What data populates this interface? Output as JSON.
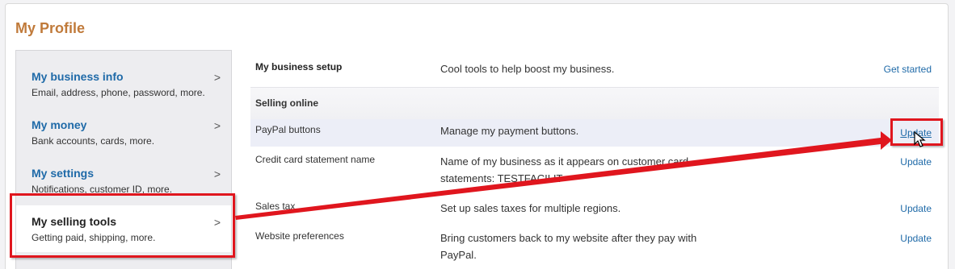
{
  "page_title": "My Profile",
  "sidebar": {
    "items": [
      {
        "label": "My business info",
        "desc": "Email, address, phone, password, more."
      },
      {
        "label": "My money",
        "desc": "Bank accounts, cards, more."
      },
      {
        "label": "My settings",
        "desc": "Notifications, customer ID, more."
      },
      {
        "label": "My selling tools",
        "desc": "Getting paid, shipping, more."
      }
    ],
    "chevron": ">"
  },
  "content": {
    "business_setup": {
      "name": "My business setup",
      "desc": "Cool tools to help boost my business.",
      "action": "Get started"
    },
    "section_title": "Selling online",
    "rows": [
      {
        "name": "PayPal buttons",
        "desc": "Manage my payment buttons.",
        "action": "Update"
      },
      {
        "name": "Credit card statement name",
        "desc": "Name of my business as it appears on customer card statements: TESTFACILIT",
        "action": "Update"
      },
      {
        "name": "Sales tax",
        "desc": "Set up sales taxes for multiple regions.",
        "action": "Update"
      },
      {
        "name": "Website preferences",
        "desc": "Bring customers back to my website after they pay with PayPal.",
        "action": "Update"
      }
    ]
  },
  "annotation": {
    "color": "#e0161e"
  }
}
